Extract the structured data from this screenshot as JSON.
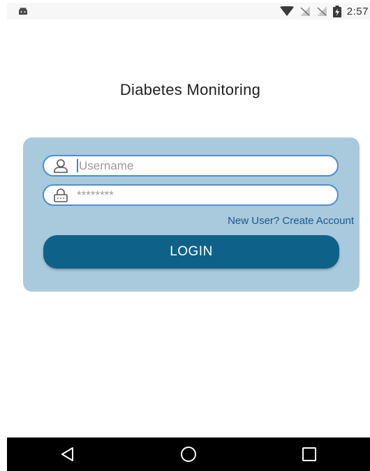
{
  "status_bar": {
    "time": "2:57",
    "icons": [
      "android-debug-icon",
      "wifi-icon",
      "no-signal-icon",
      "no-signal-icon",
      "battery-charging-icon"
    ]
  },
  "app": {
    "title": "Diabetes Monitoring"
  },
  "login_form": {
    "username_placeholder": "Username",
    "username_value": "",
    "password_placeholder": "********",
    "password_value": "",
    "create_account_link": "New User? Create Account",
    "login_button": "LOGIN"
  },
  "nav_bar": {
    "buttons": [
      "back-icon",
      "home-icon",
      "recents-icon"
    ]
  },
  "colors": {
    "card_background": "#a9c9dd",
    "field_border": "#4e8fcf",
    "button_background": "#0e6289",
    "link_color": "#1a5a87"
  }
}
